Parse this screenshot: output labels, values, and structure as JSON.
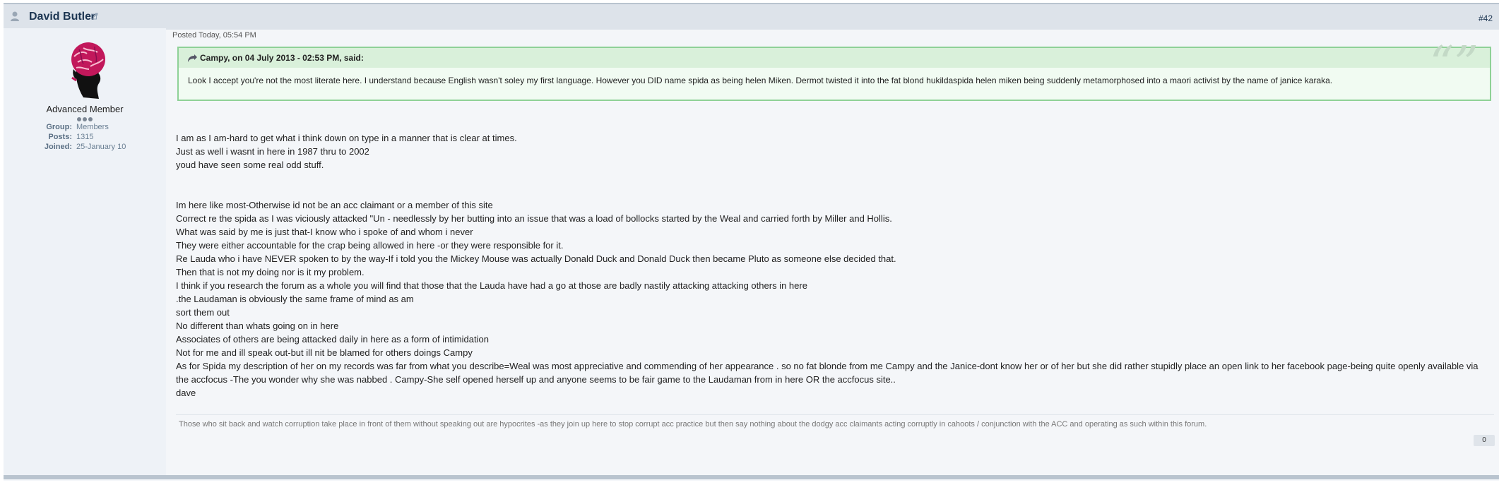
{
  "post": {
    "author_name": "David Butler",
    "post_number": "#42",
    "author": {
      "member_title": "Advanced Member",
      "info": [
        {
          "label": "Group:",
          "value": "Members"
        },
        {
          "label": "Posts:",
          "value": "1315"
        },
        {
          "label": "Joined:",
          "value": "25-January 10"
        }
      ]
    },
    "posted_date": "Posted Today, 05:54 PM",
    "quote": {
      "citation": "Campy, on 04 July 2013 - 02:53 PM, said:",
      "text": "Look I accept you're not the most literate here. I understand because English wasn't soley my first language. However you DID name spida as being helen Miken. Dermot twisted it into the fat blond hukildaspida helen miken being suddenly metamorphosed into a maori activist by the name of janice karaka."
    },
    "body_lines": [
      "I am as I am-hard to get what i think down on type in a manner that is clear at times.",
      "Just as well i wasnt in here in 1987 thru to 2002",
      "youd have seen some real odd stuff.",
      "",
      "",
      "Im here like most-Otherwise id not be an acc claimant or a member of this site",
      "Correct re the spida as I was viciously attacked \"Un - needlessly by her butting into an issue that was a load of bollocks started by the Weal and carried forth by Miller and Hollis.",
      "What was said by me is just that-I know who i spoke of and whom i never",
      "They were either accountable for the crap being allowed in here -or they were responsible for it.",
      "Re Lauda who i have NEVER spoken to by the way-If i told you the Mickey Mouse was actually Donald Duck and Donald Duck then became Pluto as someone else decided that.",
      "Then that is not my doing nor is it my problem.",
      "I think if you research the forum as a whole you will find that those that the Lauda have had a go at those are badly nastily attacking attacking others in here",
      ".the Laudaman is obviously the same frame of mind as am",
      "sort them out",
      "No different than whats going on in here",
      "Associates of others are being attacked daily in here as a form of intimidation",
      "Not for me and ill speak out-but ill nit be blamed for others doings Campy",
      "As for Spida my description of her on my records was far from what you describe=Weal was most appreciative and commending of her appearance . so no fat blonde from me Campy and the Janice-dont know her or of her but she did rather stupidly place an open link to her facebook page-being quite openly available via the accfocus -The you wonder why she was nabbed . Campy-She self opened herself up and anyone seems to be fair game to the Laudaman from in here OR the accfocus site..",
      "dave"
    ],
    "signature": "Those who sit back and watch corruption take place in front of them without speaking out are hypocrites -as they join up here to stop corrupt acc practice but then say nothing about the dodgy acc claimants acting corruptly in cahoots / conjunction with the ACC and operating as such within this forum.",
    "reputation": "0"
  }
}
